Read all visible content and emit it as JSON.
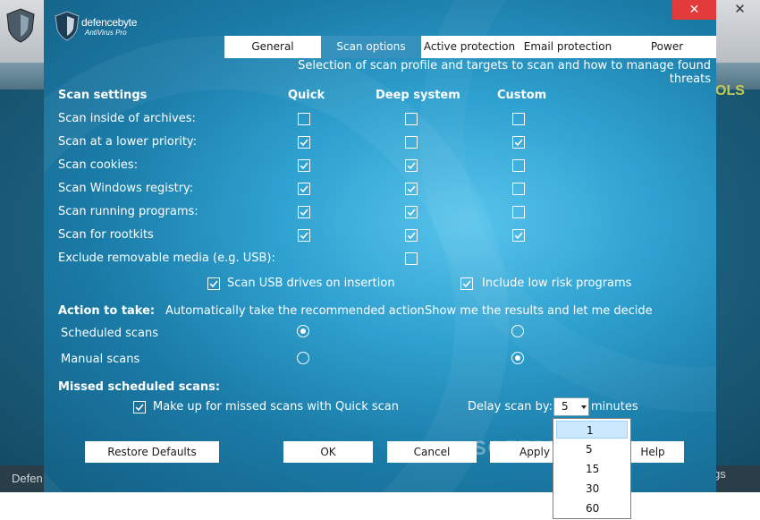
{
  "background": {
    "tools_fragment": "OLS",
    "bottom_left_fragment": "Defen",
    "bottom_right_fragment": "gs"
  },
  "logo": {
    "name": "defencebyte",
    "subtitle": "AntiVirus Pro"
  },
  "close_glyph": "✕",
  "tabs": [
    {
      "label": "General",
      "active": false
    },
    {
      "label": "Scan options",
      "active": true
    },
    {
      "label": "Active protection",
      "active": false
    },
    {
      "label": "Email protection",
      "active": false
    },
    {
      "label": "Power",
      "active": false
    }
  ],
  "subtitle": "Selection of scan profile and targets to scan and how to manage found threats",
  "scan_settings": {
    "heading": "Scan settings",
    "columns": [
      "Quick",
      "Deep system",
      "Custom"
    ],
    "rows": [
      {
        "label": "Scan inside of archives:",
        "quick": false,
        "deep": false,
        "custom": false
      },
      {
        "label": "Scan at a lower priority:",
        "quick": true,
        "deep": false,
        "custom": true
      },
      {
        "label": "Scan cookies:",
        "quick": true,
        "deep": true,
        "custom": false
      },
      {
        "label": "Scan Windows registry:",
        "quick": true,
        "deep": true,
        "custom": false
      },
      {
        "label": "Scan running programs:",
        "quick": true,
        "deep": true,
        "custom": false
      },
      {
        "label": "Scan for rootkits",
        "quick": true,
        "deep": true,
        "custom": true
      }
    ],
    "exclude_removable": {
      "label": "Exclude removable media (e.g. USB):",
      "checked": false
    },
    "scan_usb": {
      "label": "Scan USB drives on insertion",
      "checked": true
    },
    "include_low_risk": {
      "label": "Include low risk programs",
      "checked": true
    }
  },
  "actions": {
    "heading": "Action to take:",
    "option_auto": "Automatically take the recommended action",
    "option_show": "Show me the results and let me decide",
    "scheduled": {
      "label": "Scheduled scans",
      "selected": "auto"
    },
    "manual": {
      "label": "Manual scans",
      "selected": "show"
    }
  },
  "missed": {
    "heading": "Missed scheduled scans:",
    "makeup": {
      "label": "Make up for missed scans with Quick scan",
      "checked": true
    },
    "delay_label": "Delay scan by:",
    "delay_value": "5",
    "delay_unit": "minutes",
    "delay_options": [
      "1",
      "5",
      "15",
      "30",
      "60"
    ],
    "highlighted_option": "1"
  },
  "buttons": {
    "restore": "Restore Defaults",
    "ok": "OK",
    "cancel": "Cancel",
    "apply": "Apply",
    "help": "Help"
  },
  "watermark": "SOFTPEDIA",
  "colors": {
    "accent_tab": "#3791bd",
    "close_red": "#e33b3b",
    "dialog_center": "#57c4ec",
    "dialog_edge": "#135e83"
  }
}
